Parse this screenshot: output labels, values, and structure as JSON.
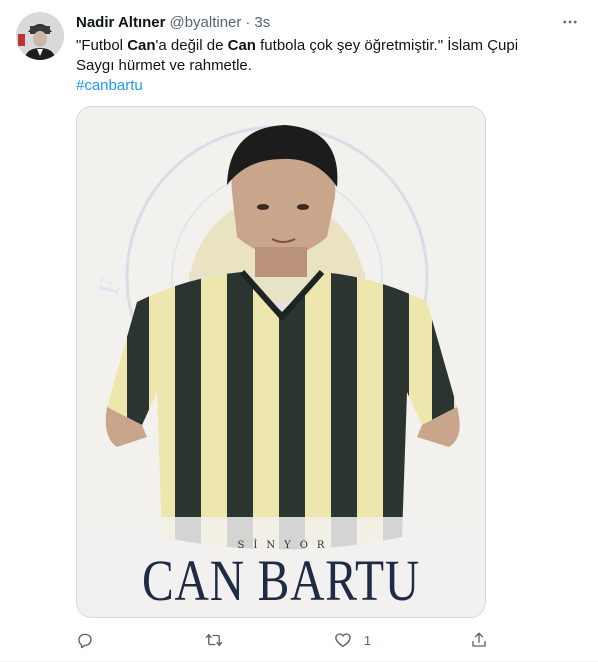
{
  "tweet": {
    "author_name": "Nadir Altıner",
    "handle": "@byaltiner",
    "separator": "·",
    "time": "3s",
    "text_lead": "\"Futbol ",
    "text_bold_1": "Can",
    "text_mid_1": "'a değil de ",
    "text_bold_2": "Can",
    "text_mid_2": " futbola çok şey öğretmiştir.\" İslam Çupi",
    "text_line_2": "Saygı hürmet ve rahmetle.",
    "hashtag": "#canbartu"
  },
  "media": {
    "poster_subtitle": "SİNYOR",
    "poster_title": "CAN BARTU",
    "badge_text": "FENERBAHÇE SPOR KULÜBÜ",
    "colors": {
      "navy": "#1f2a44",
      "stripe_yellow": "#ede7ad",
      "stripe_dark": "#2a3430",
      "badge_red": "#e7c3c2",
      "badge_blue": "#c9d3e6"
    }
  },
  "actions": {
    "reply_count": "",
    "retweet_count": "",
    "like_count": "1",
    "share_count": ""
  },
  "icons": {
    "more": "more-horizontal-icon",
    "reply": "reply-icon",
    "retweet": "retweet-icon",
    "like": "heart-icon",
    "share": "share-icon"
  },
  "theme": {
    "link_color": "#1d9bf0",
    "secondary_text": "#536471"
  }
}
